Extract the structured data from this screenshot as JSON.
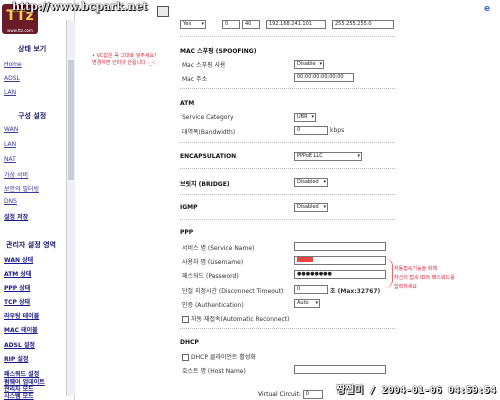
{
  "watermark_top": "http://www.bcpark.net",
  "watermark_bottom": "짱쩔미 / 2004-01-06 04:59:54",
  "sidebar": {
    "logo_text": "TTz",
    "logo_sub": "www.ttz.com",
    "status_heading": "상태 보기",
    "status_links": [
      "Home",
      "ADSL",
      "LAN"
    ],
    "config_heading": "구성 설정",
    "config_links": [
      "WAN",
      "LAN",
      "NAT",
      "가상 서버",
      "보안의 필터링",
      "DNS",
      "설정 저장"
    ],
    "admin_heading": "관리자 설정 영역",
    "admin_links": [
      "WAN 상태",
      "ATM 상태",
      "PPP 상태",
      "TCP 상태",
      "라우팅 테이블",
      "MAC 테이블",
      "ADSL 설정",
      "RIP 설정",
      "패스워드 설정",
      "펌웨어 업데이트",
      "관리자 모드",
      "시스템 모드"
    ]
  },
  "notes": {
    "left_line1": "• VC값은 꼭 그대로 넣주세요!",
    "left_line2": "변경하면 인터넷 안됩니다 -_-;",
    "right_line1": "자동접속기능을 위해",
    "right_line2": "자신의 접속 ID와 패스워드를",
    "right_line3": "입력하세요"
  },
  "top_row": {
    "yes_select": "Yes",
    "vpi": "0",
    "vci": "40",
    "ip": "192.168.241.101",
    "mask": "255.255.255.0"
  },
  "mac": {
    "section": "MAC 스푸핑 (SPOOFING)",
    "label_spoof": "Mac 스푸핑 사용",
    "spoof_value": "Disable",
    "label_addr": "Mac 주소",
    "addr_value": "00:00:00:00:00:00"
  },
  "atm": {
    "section": "ATM",
    "label_category": "Service Category",
    "category_value": "UBR",
    "label_bw": "대역폭(Bandwidth)",
    "bw_value": "0",
    "bw_unit": "kbps"
  },
  "encap": {
    "section": "ENCAPSULATION",
    "value": "PPPoE LLC"
  },
  "bridge": {
    "section": "브릿지 (BRIDGE)",
    "value": "Disabled"
  },
  "igmp": {
    "section": "IGMP",
    "value": "Disabled"
  },
  "ppp": {
    "section": "PPP",
    "label_service": "서비스 명 (Service Name)",
    "service_value": "",
    "label_user": "사용자 명 (Username)",
    "user_value": "",
    "label_pass": "패스워드 (Password)",
    "pass_value": "●●●●●●●●",
    "label_timeout": "단절 지정시간 (Disconnect Timeout)",
    "timeout_value": "0",
    "timeout_unit": "초 (Max:32767)",
    "label_auth": "인증 (Authentication)",
    "auth_value": "Auto",
    "label_reconnect": "자동 재접속(Automatic Reconnect)"
  },
  "dhcp": {
    "section": "DHCP",
    "label_relay": "DHCP 클라이언트 활성화",
    "label_host": "호스트 명 (Host Name)",
    "host_value": ""
  },
  "footer": {
    "vc_label": "Virtual Circuit:",
    "vc_value": "0"
  }
}
